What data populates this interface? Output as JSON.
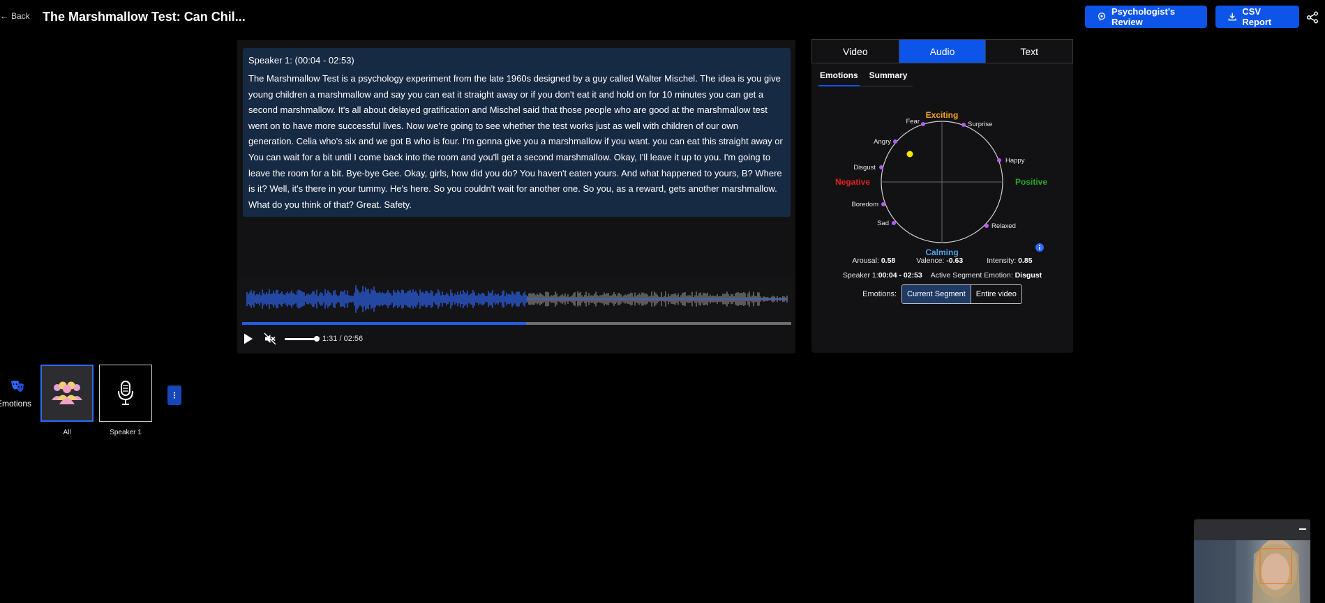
{
  "header": {
    "back_label": "Back",
    "title": "The Marshmallow Test: Can Chil...",
    "psych_review_label": "Psychologist's Review",
    "csv_label": "CSV Report"
  },
  "transcript": {
    "speaker_header": "Speaker 1: (00:04 - 02:53)",
    "text": "The Marshmallow Test is a psychology experiment from the late 1960s designed by a guy called Walter Mischel. The idea is you give young children a marshmallow and say you can eat it straight away or if you don't eat it and hold on for 10 minutes you can get a second marshmallow. It's all about delayed gratification and Mischel said that those people who are good at the marshmallow test went on to have more successful lives. Now we're going to see whether the test works just as well with children of our own generation. Celia who's six and we got B who is four. I'm gonna give you a marshmallow if you want. you can eat this straight away or You can wait for a bit until I come back into the room and you'll get a second marshmallow. Okay, I'll leave it up to you. I'm going to leave the room for a bit. Bye-bye Gee. Okay, girls, how did you do? You haven't eaten yours. And what happened to yours, B? Where is it? Well, it's there in your tummy. He's here. So you couldn't wait for another one. So you, as a reward, gets another marshmallow. What do you think of that? Great. Safety."
  },
  "player": {
    "time_display": "1:31 / 02:56",
    "progress_fraction": 0.517,
    "volume_fraction": 0.85
  },
  "panel": {
    "tabs": [
      "Video",
      "Audio",
      "Text"
    ],
    "active_tab": "Audio",
    "subtabs": [
      "Emotions",
      "Summary"
    ],
    "active_subtab": "Emotions",
    "circumplex": {
      "top": "Exciting",
      "bottom": "Calming",
      "left": "Negative",
      "right": "Positive",
      "emotions": [
        "Fear",
        "Surprise",
        "Angry",
        "Happy",
        "Disgust",
        "Boredom",
        "Relaxed",
        "Sad"
      ],
      "top_color": "#f5a623",
      "bottom_color": "#4aa3e8",
      "left_color": "#e02020",
      "right_color": "#2aa52a",
      "marker_color": "#ffe600",
      "dot_color": "#b45cf0"
    },
    "metrics": {
      "arousal_label": "Arousal:",
      "arousal": "0.58",
      "valence_label": "Valence:",
      "valence": "-0.63",
      "intensity_label": "Intensity:",
      "intensity": "0.85",
      "speaker_label": "Speaker 1:",
      "speaker_range": "00:04 - 02:53",
      "active_label": "Active Segment Emotion:",
      "active_emotion": "Disgust"
    },
    "emotions_toggle": {
      "label": "Emotions:",
      "options": [
        "Current Segment",
        "Entire video"
      ],
      "active": "Current Segment"
    }
  },
  "selector": {
    "side_label": "Emotions",
    "cards": [
      "All",
      "Speaker 1"
    ],
    "active_card": "All"
  },
  "colors": {
    "accent": "#0d55e8",
    "waveform_played": "#2f6bff",
    "waveform_unplayed": "#8a8a8a"
  }
}
